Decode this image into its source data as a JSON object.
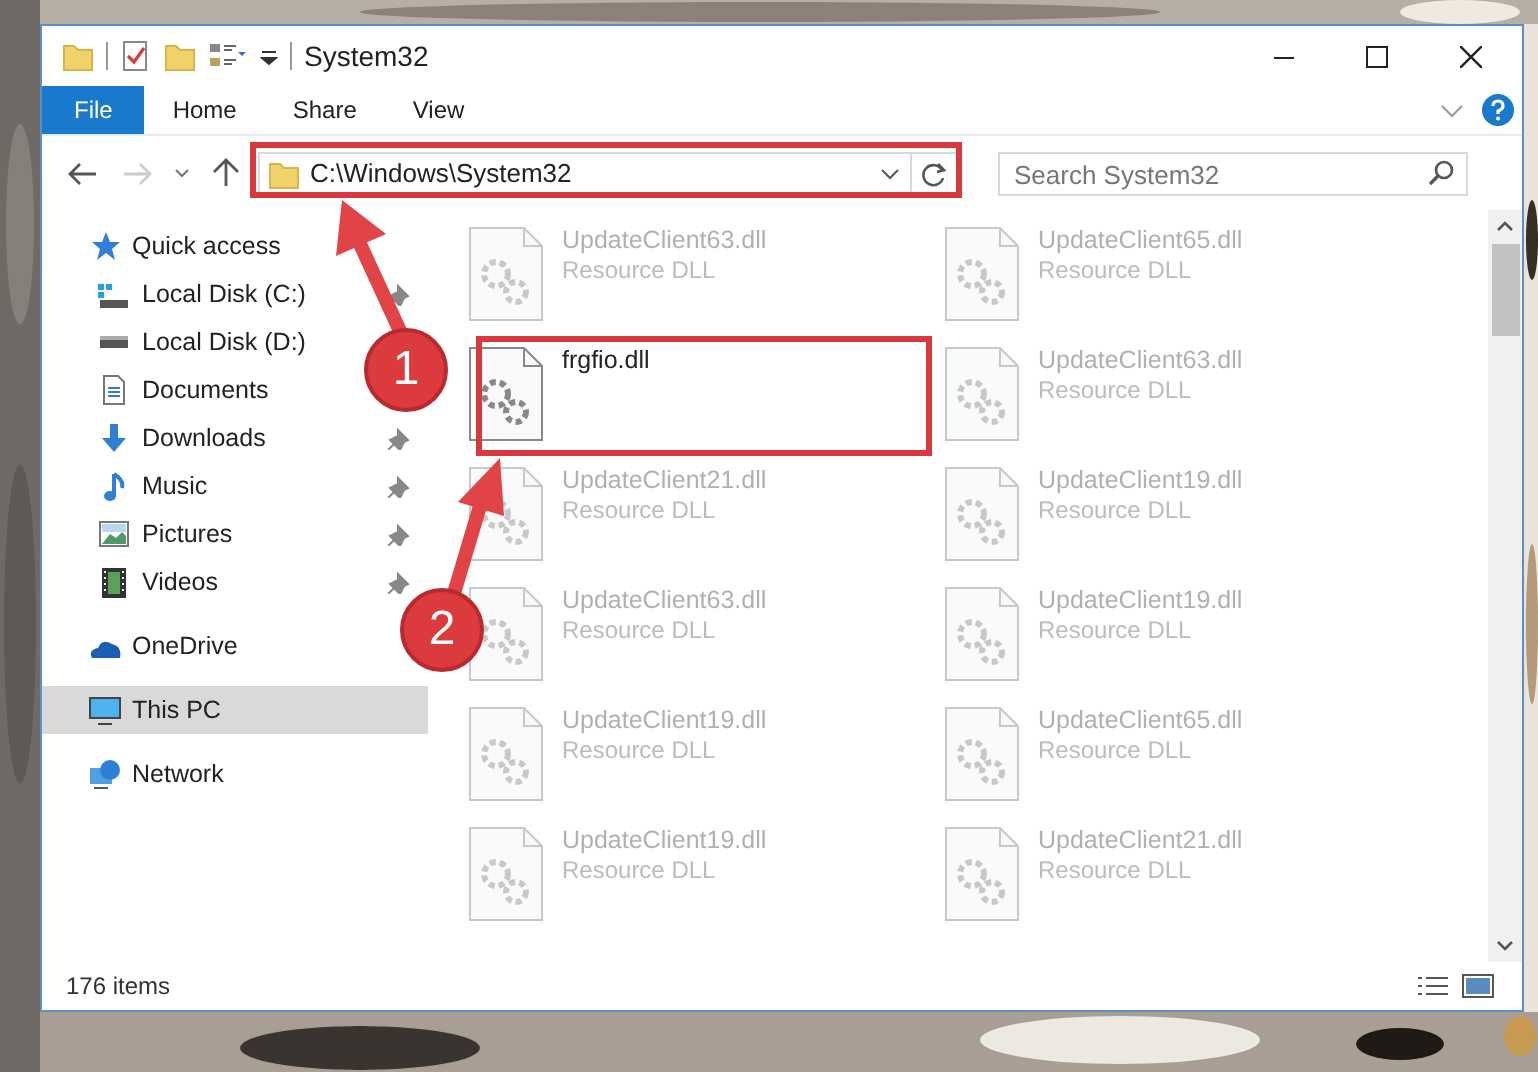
{
  "window": {
    "title": "System32"
  },
  "ribbon_tabs": [
    {
      "label": "File",
      "kind": "file"
    },
    {
      "label": "Home",
      "kind": "tab"
    },
    {
      "label": "Share",
      "kind": "tab"
    },
    {
      "label": "View",
      "kind": "tab"
    }
  ],
  "address_bar": {
    "path": "C:\\Windows\\System32"
  },
  "search": {
    "placeholder": "Search System32"
  },
  "sidebar": {
    "items": [
      {
        "label": "Quick access",
        "selected": false,
        "children": [
          {
            "label": "Local Disk (C:)",
            "pinned": true
          },
          {
            "label": "Local Disk (D:)",
            "pinned": false
          },
          {
            "label": "Documents",
            "pinned": false
          },
          {
            "label": "Downloads",
            "pinned": true
          },
          {
            "label": "Music",
            "pinned": true
          },
          {
            "label": "Pictures",
            "pinned": true
          },
          {
            "label": "Videos",
            "pinned": true
          }
        ]
      },
      {
        "label": "OneDrive",
        "selected": false
      },
      {
        "label": "This PC",
        "selected": true
      },
      {
        "label": "Network",
        "selected": false
      }
    ]
  },
  "files": [
    {
      "name": "UpdateClient63.dll",
      "type": "Resource DLL",
      "faded": true
    },
    {
      "name": "UpdateClient65.dll",
      "type": "Resource DLL",
      "faded": true
    },
    {
      "name": "frgfio.dll",
      "faded": false
    },
    {
      "name": "UpdateClient63.dll",
      "type": "Resource DLL",
      "faded": true
    },
    {
      "name": "UpdateClient21.dll",
      "type": "Resource DLL",
      "faded": true
    },
    {
      "name": "UpdateClient19.dll",
      "type": "Resource DLL",
      "faded": true
    },
    {
      "name": "UpdateClient63.dll",
      "type": "Resource DLL",
      "faded": true
    },
    {
      "name": "UpdateClient19.dll",
      "type": "Resource DLL",
      "faded": true
    },
    {
      "name": "UpdateClient19.dll",
      "type": "Resource DLL",
      "faded": true
    },
    {
      "name": "UpdateClient65.dll",
      "type": "Resource DLL",
      "faded": true
    },
    {
      "name": "UpdateClient19.dll",
      "type": "Resource DLL",
      "faded": true
    },
    {
      "name": "UpdateClient21.dll",
      "type": "Resource DLL",
      "faded": true
    }
  ],
  "status_bar": {
    "item_count": "176 items"
  },
  "callouts": [
    {
      "number": "1"
    },
    {
      "number": "2"
    }
  ]
}
